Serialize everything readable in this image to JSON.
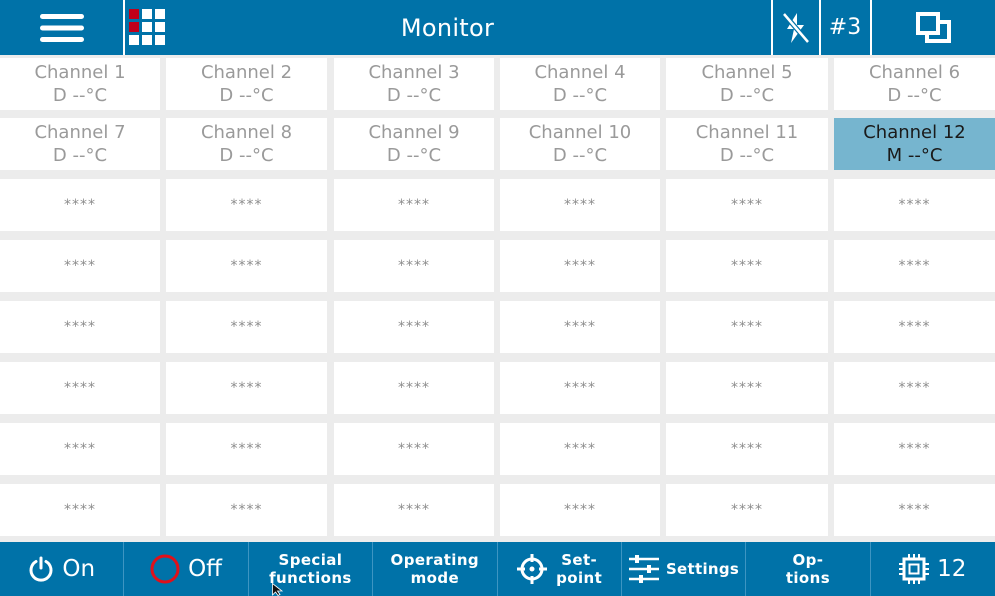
{
  "header": {
    "title": "Monitor",
    "channel_indicator": "#3"
  },
  "channels": [
    {
      "name": "Channel 1",
      "value": "D --°C"
    },
    {
      "name": "Channel 2",
      "value": "D --°C"
    },
    {
      "name": "Channel 3",
      "value": "D --°C"
    },
    {
      "name": "Channel 4",
      "value": "D --°C"
    },
    {
      "name": "Channel 5",
      "value": "D --°C"
    },
    {
      "name": "Channel 6",
      "value": "D --°C"
    },
    {
      "name": "Channel 7",
      "value": "D --°C"
    },
    {
      "name": "Channel 8",
      "value": "D --°C"
    },
    {
      "name": "Channel 9",
      "value": "D --°C"
    },
    {
      "name": "Channel 10",
      "value": "D --°C"
    },
    {
      "name": "Channel 11",
      "value": "D --°C"
    },
    {
      "name": "Channel 12",
      "value": "M --°C",
      "selected": true
    }
  ],
  "empty_slot_text": "****",
  "empty_slot_count": 36,
  "footer": {
    "on_label": "On",
    "off_label": "Off",
    "special_functions_line1": "Special",
    "special_functions_line2": "functions",
    "operating_mode_line1": "Operating",
    "operating_mode_line2": "mode",
    "setpoint_line1": "Set-",
    "setpoint_line2": "point",
    "settings_label": "Settings",
    "options_line1": "Op-",
    "options_line2": "tions",
    "channel_count": "12"
  },
  "colors": {
    "bar": "#0072a8",
    "selected_cell": "#76b5cf",
    "off_icon": "#e0101a",
    "grid_icon_accent": "#c0001a"
  },
  "icons": {
    "menu": "hamburger-icon",
    "overview": "grid-icon",
    "flash_disabled": "flash-off-icon",
    "windows": "windows-icon",
    "power": "power-icon",
    "off": "circle-icon",
    "setpoint": "crosshair-icon",
    "settings": "sliders-icon",
    "channels": "chip-icon"
  }
}
